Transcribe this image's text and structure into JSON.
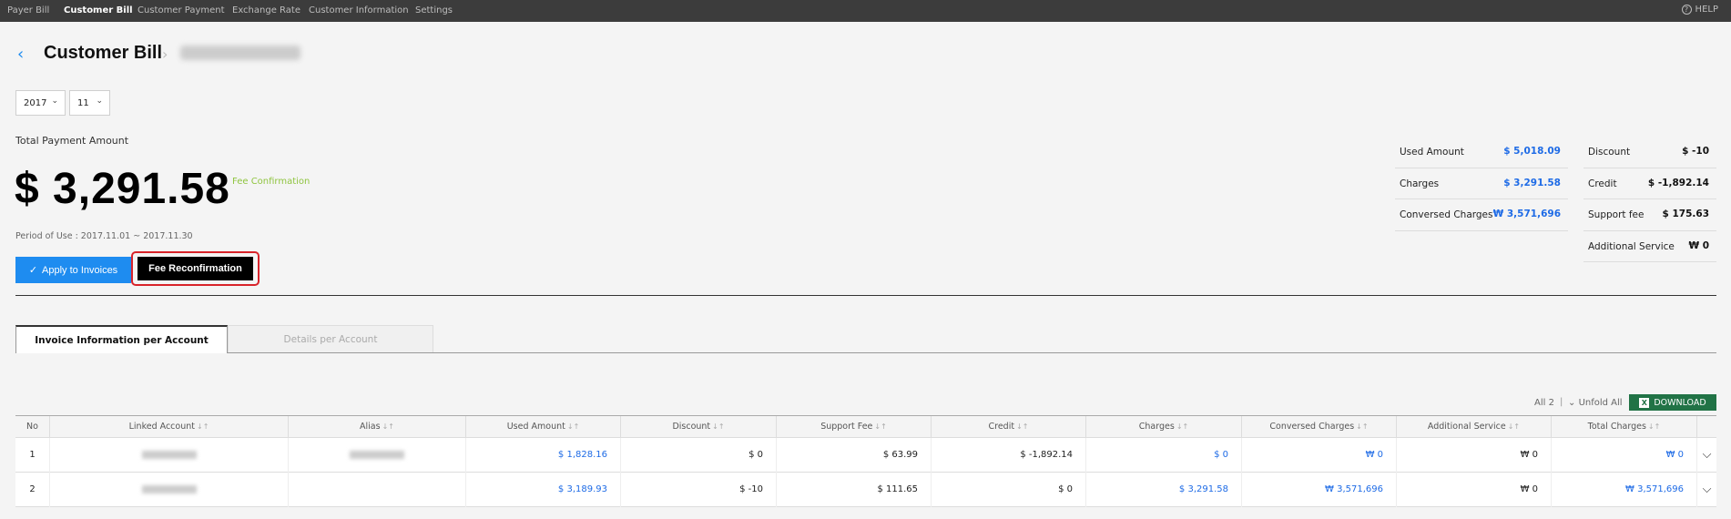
{
  "topnav": {
    "items": [
      {
        "label": "Payer Bill",
        "active": false
      },
      {
        "label": "Customer Bill",
        "active": true
      },
      {
        "label": "Customer Payment",
        "active": false
      },
      {
        "label": "Exchange Rate",
        "active": false
      },
      {
        "label": "Customer Information",
        "active": false
      },
      {
        "label": "Settings",
        "active": false
      }
    ],
    "help_label": "HELP"
  },
  "header": {
    "title": "Customer Bill"
  },
  "filters": {
    "year": "2017",
    "month": "11"
  },
  "payment": {
    "label": "Total Payment Amount",
    "amount": "$ 3,291.58",
    "fee_confirmation": "Fee Confirmation",
    "period": "Period of Use : 2017.11.01 ~ 2017.11.30",
    "apply_button": "Apply to Invoices",
    "reconfirm_button": "Fee Reconfirmation"
  },
  "summary_left": [
    {
      "label": "Used Amount",
      "value": "$ 5,018.09",
      "color": "blue"
    },
    {
      "label": "Charges",
      "value": "$ 3,291.58",
      "color": "blue"
    },
    {
      "label": "Conversed Charges",
      "value": "₩ 3,571,696",
      "color": "blue"
    }
  ],
  "summary_right": [
    {
      "label": "Discount",
      "value": "$ -10"
    },
    {
      "label": "Credit",
      "value": "$ -1,892.14"
    },
    {
      "label": "Support fee",
      "value": "$ 175.63"
    },
    {
      "label": "Additional Service",
      "value": "₩ 0"
    }
  ],
  "tabs": [
    {
      "label": "Invoice Information per Account",
      "active": true
    },
    {
      "label": "Details per Account",
      "active": false
    }
  ],
  "table_controls": {
    "count": "All 2",
    "separator": "|",
    "unfold": "Unfold All",
    "download": "DOWNLOAD"
  },
  "table": {
    "headers": [
      "No",
      "Linked Account",
      "Alias",
      "Used Amount",
      "Discount",
      "Support Fee",
      "Credit",
      "Charges",
      "Conversed Charges",
      "Additional Service",
      "Total Charges"
    ],
    "rows": [
      {
        "no": "1",
        "used": "$ 1,828.16",
        "discount": "$ 0",
        "support": "$ 63.99",
        "credit": "$ -1,892.14",
        "charges": "$ 0",
        "conversed": "₩ 0",
        "additional": "₩ 0",
        "total": "₩ 0"
      },
      {
        "no": "2",
        "used": "$ 3,189.93",
        "discount": "$ -10",
        "support": "$ 111.65",
        "credit": "$ 0",
        "charges": "$ 3,291.58",
        "conversed": "₩ 3,571,696",
        "additional": "₩ 0",
        "total": "₩ 3,571,696"
      }
    ]
  },
  "icons": {
    "back": "chevron-left-icon",
    "help": "question-circle-icon",
    "check": "check-icon",
    "excel": "excel-icon",
    "expand": "chevron-down-icon"
  }
}
